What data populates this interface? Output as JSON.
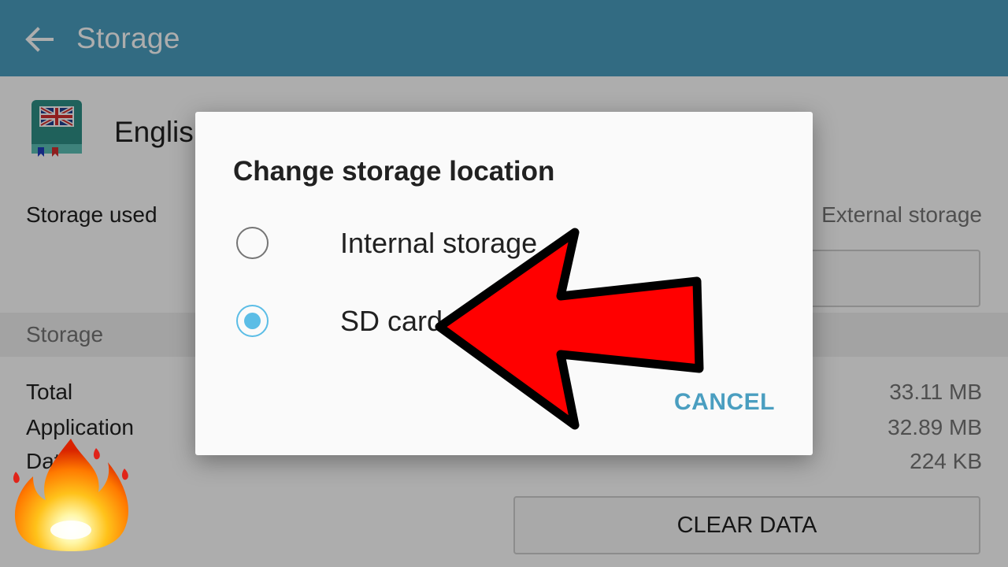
{
  "appbar": {
    "title": "Storage",
    "back_icon": "arrow-left-icon"
  },
  "app": {
    "name": "English",
    "icon": "uk-flag-book-icon"
  },
  "storage_used": {
    "label": "Storage used",
    "value": "External storage"
  },
  "storage_section": {
    "header": "Storage",
    "rows": [
      {
        "label": "Total",
        "value": "33.11 MB"
      },
      {
        "label": "Application",
        "value": "32.89 MB"
      },
      {
        "label": "Data",
        "value": "224 KB"
      }
    ],
    "clear_button": "CLEAR DATA"
  },
  "dialog": {
    "title": "Change storage location",
    "options": [
      {
        "label": "Internal storage",
        "selected": false
      },
      {
        "label": "SD card",
        "selected": true
      }
    ],
    "cancel_label": "CANCEL"
  },
  "overlay": {
    "arrow_icon": "red-arrow-icon",
    "fire_icon": "fire-emoji-icon"
  },
  "colors": {
    "appbar": "#4a9ec0",
    "accent": "#5bbde6",
    "arrow": "#ff0000"
  }
}
